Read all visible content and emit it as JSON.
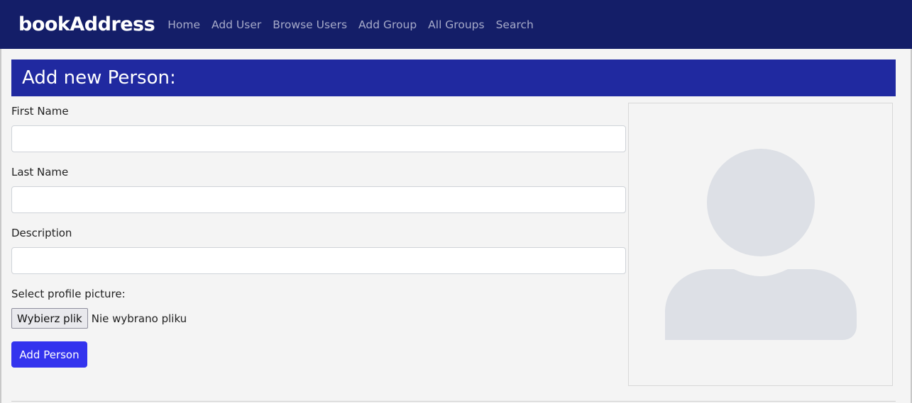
{
  "navbar": {
    "brand": "bookAddress",
    "links": [
      "Home",
      "Add User",
      "Browse Users",
      "Add Group",
      "All Groups",
      "Search"
    ]
  },
  "header": {
    "title": "Add new Person:"
  },
  "form": {
    "first_name": {
      "label": "First Name",
      "value": ""
    },
    "last_name": {
      "label": "Last Name",
      "value": ""
    },
    "description": {
      "label": "Description",
      "value": ""
    },
    "picture": {
      "label": "Select profile picture:",
      "button_label": "Wybierz plik",
      "status": "Nie wybrano pliku"
    },
    "submit_label": "Add Person"
  },
  "avatar": {
    "icon": "user-placeholder-icon",
    "color": "#dde0e6"
  },
  "colors": {
    "navbar_bg": "#141e68",
    "header_bg": "#2029a0",
    "button_bg": "#3333ee",
    "page_bg": "#f4f4f4"
  }
}
